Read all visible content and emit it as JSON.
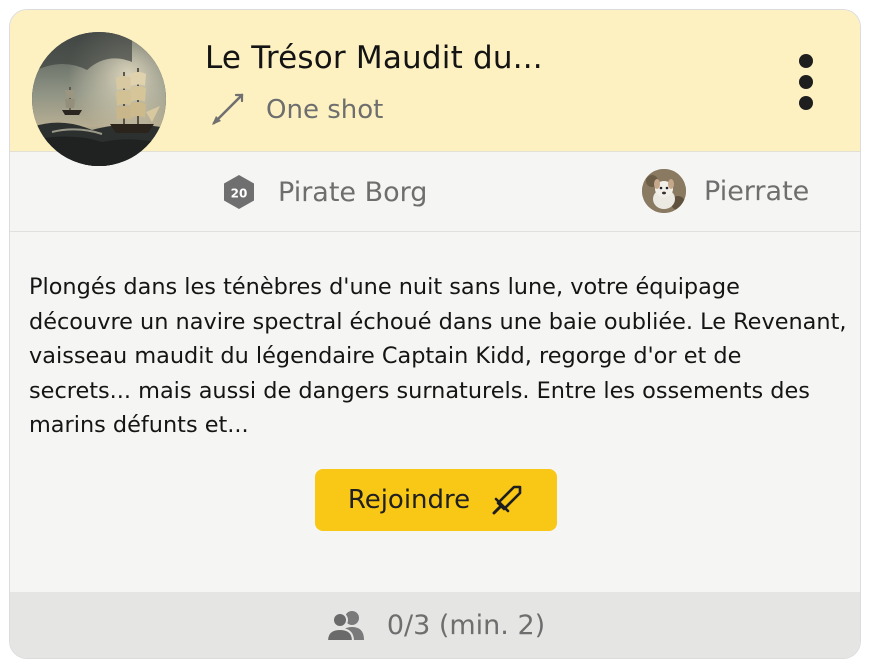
{
  "campaign": {
    "title": "Le Trésor Maudit du...",
    "type_label": "One shot",
    "cover_image": "sailing-ship-storm-painting"
  },
  "meta": {
    "system": {
      "label": "Pirate Borg",
      "icon": "d20-icon",
      "die_value": "20"
    },
    "game_master": {
      "name": "Pierrate",
      "avatar": "dog-avatar"
    }
  },
  "description": "Plongés dans les ténèbres d'une nuit sans lune, votre équipage découvre un navire spectral échoué dans une baie oubliée. Le Revenant, vaisseau maudit du légendaire Captain Kidd, regorge d'or et de secrets... mais aussi de dangers surnaturels. Entre les ossements des marins défunts et...",
  "actions": {
    "join_label": "Rejoindre",
    "join_icon": "sword-icon"
  },
  "footer": {
    "players_icon": "users-icon",
    "players_text": "0/3 (min. 2)"
  },
  "colors": {
    "header_bg": "#fdf1c2",
    "accent_button": "#f9c816",
    "card_bg": "#f5f5f3",
    "footer_bg": "#e5e5e4",
    "muted_text": "#6e6e6e"
  }
}
